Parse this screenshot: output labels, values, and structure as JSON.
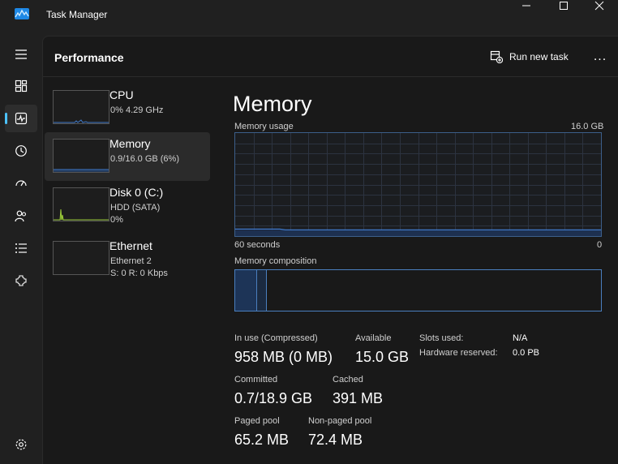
{
  "window": {
    "title": "Task Manager"
  },
  "header": {
    "page_title": "Performance",
    "run_task_label": "Run new task",
    "more_label": "..."
  },
  "nav": {
    "items": [
      {
        "icon": "hamburger-menu-icon"
      },
      {
        "icon": "processes-icon"
      },
      {
        "icon": "performance-icon",
        "active": true
      },
      {
        "icon": "app-history-icon"
      },
      {
        "icon": "startup-apps-icon"
      },
      {
        "icon": "users-icon"
      },
      {
        "icon": "details-icon"
      },
      {
        "icon": "services-icon"
      }
    ],
    "settings_icon": "settings-icon"
  },
  "resources": [
    {
      "name": "CPU",
      "sub1": "0%  4.29 GHz",
      "sub2": "",
      "sub3": ""
    },
    {
      "name": "Memory",
      "sub1": "0.9/16.0 GB (6%)",
      "sub2": "",
      "sub3": ""
    },
    {
      "name": "Disk 0 (C:)",
      "sub1": "HDD (SATA)",
      "sub2": "0%",
      "sub3": ""
    },
    {
      "name": "Ethernet",
      "sub1": "Ethernet 2",
      "sub2": "S: 0  R: 0 Kbps",
      "sub3": ""
    }
  ],
  "memory": {
    "title": "Memory",
    "usage_label": "Memory usage",
    "usage_max": "16.0 GB",
    "time_left": "60 seconds",
    "time_right": "0",
    "composition_label": "Memory composition",
    "usage_percent": 6,
    "stats": {
      "in_use_label": "In use (Compressed)",
      "in_use_value": "958 MB (0 MB)",
      "available_label": "Available",
      "available_value": "15.0 GB",
      "slots_label": "Slots used:",
      "slots_value": "N/A",
      "hw_reserved_label": "Hardware reserved:",
      "hw_reserved_value": "0.0 PB",
      "committed_label": "Committed",
      "committed_value": "0.7/18.9 GB",
      "cached_label": "Cached",
      "cached_value": "391 MB",
      "paged_label": "Paged pool",
      "paged_value": "65.2 MB",
      "nonpaged_label": "Non-paged pool",
      "nonpaged_value": "72.4 MB"
    }
  },
  "colors": {
    "accent": "#4cc2ff",
    "memory_line": "#3e77c6",
    "disk_line": "#9ccc3a"
  }
}
